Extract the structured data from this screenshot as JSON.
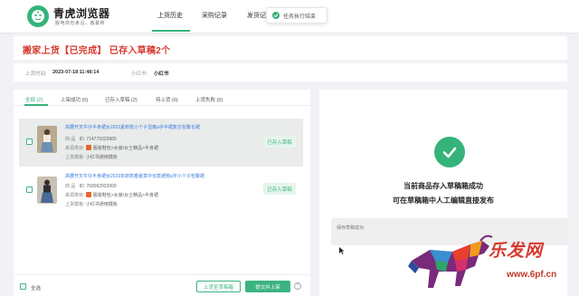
{
  "header": {
    "brand": "青虎浏览器",
    "tagline": "搬电商包孝沿，搬幕蒋",
    "nav": [
      "上货历史",
      "采购记录",
      "发货记"
    ],
    "active_nav": "上货历史"
  },
  "toast": {
    "text": "任务执行结束"
  },
  "page_title": "搬家上货【已完成】 已存入草稿2个",
  "meta": {
    "time_label": "上货时间:",
    "time_value": "2023-07-18 11:48:14",
    "shop_label": "小红书:",
    "shop_value": "小红书"
  },
  "tabs": [
    {
      "label": "全部 (2)",
      "active": true
    },
    {
      "label": "上架成功 (0)"
    },
    {
      "label": "已存入草稿 (2)"
    },
    {
      "label": "待上货 (0)"
    },
    {
      "label": "上货失败 (0)"
    }
  ],
  "products": [
    {
      "title": "高腰开叉牛仔半身裙女2023夏新款小个子显瘦a字半裙复古包臀长裙",
      "id_label": "商 品",
      "id_value": "ID: 714779325965",
      "source_label": "来源类目:",
      "source_value": "服装鞋包>女装/女士精品>半身裙",
      "template_label": "上货模板:",
      "template_value": "小红书通用模板",
      "status": "已存入草稿"
    },
    {
      "title": "高腰开叉牛仔半身裙女2023年新款春夏季中长款遮胯a字小个子包臀裙",
      "id_label": "商 品",
      "id_value": "ID: 703062932609",
      "source_label": "来源类目:",
      "source_value": "服装鞋包>女装/女士精品>半身裙",
      "template_label": "上货模板:",
      "template_value": "小红书通用模板",
      "status": "已存入草稿"
    }
  ],
  "footer": {
    "select_all": "全选",
    "btn_draft": "上货至草稿箱",
    "btn_publish": "提交并上架",
    "help": "?"
  },
  "result": {
    "line1": "当前商品存入草稿箱成功",
    "line2": "可在草稿箱中人工编辑直接发布",
    "log": "保存草稿成功"
  },
  "watermark": {
    "text": "乐发网",
    "url": "www.6pf.cn"
  },
  "colors": {
    "accent": "#35b37a",
    "title_red": "#d63a2f",
    "link_blue": "#3a7be0"
  }
}
